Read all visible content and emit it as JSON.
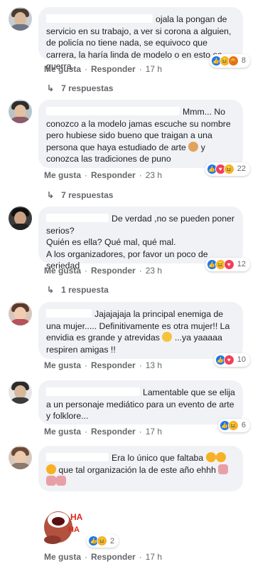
{
  "comments": [
    {
      "text": "ojala la pongan de servicio en su trabajo, a ver si corona a alguien, de policía no tiene nada, se equivoco que carrera, la haría linda de modelo o en esto es guerra.",
      "reaction_count": "8",
      "actions": {
        "like": "Me gusta",
        "reply": "Responder",
        "time": "17 h"
      },
      "replies": "7 respuestas"
    },
    {
      "text": "Mmm... No conozco a la modelo jamas escuche su nombre pero hubiese sido bueno que traigan a una persona que haya estudiado de arte",
      "text_tail": "y conozca las tradiciones de puno",
      "reaction_count": "22",
      "actions": {
        "like": "Me gusta",
        "reply": "Responder",
        "time": "23 h"
      },
      "replies": "7 respuestas"
    },
    {
      "text": "De verdad ,no se pueden poner serios?",
      "line2": "Quién es ella? Qué mal, qué mal.",
      "line3": "A los organizadores, por favor un poco de seriedad",
      "reaction_count": "12",
      "actions": {
        "like": "Me gusta",
        "reply": "Responder",
        "time": "23 h"
      },
      "replies": "1 respuesta"
    },
    {
      "text": "Jajajajaja la principal enemiga de una mujer..... Definitivamente es otra mujer!! La envidia es grande y atrevidas",
      "text_tail": "...ya yaaaaa respiren amigas !!",
      "reaction_count": "10",
      "actions": {
        "like": "Me gusta",
        "reply": "Responder",
        "time": "13 h"
      }
    },
    {
      "text": "Lamentable que se elija a un personaje mediático para un evento de arte y folklore...",
      "reaction_count": "6",
      "actions": {
        "like": "Me gusta",
        "reply": "Responder",
        "time": "17 h"
      }
    },
    {
      "text": "Era lo único que faltaba",
      "text_tail": "que tal organización la de este año ehhh",
      "actions": {
        "like": "Me gusta",
        "reply": "Responder",
        "time": "17 h"
      }
    }
  ],
  "sticker": {
    "label": "HA HA",
    "reaction_count": "2",
    "actions": {
      "like": "Me gusta",
      "reply": "Responder",
      "time": "17 h"
    }
  },
  "icons": {
    "reply_arrow": "reply-arrow-icon"
  }
}
